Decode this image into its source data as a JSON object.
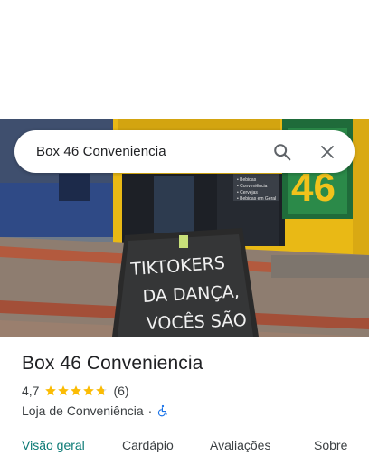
{
  "search": {
    "query": "Box 46 Conveniencia"
  },
  "place": {
    "title": "Box 46 Conveniencia",
    "rating": "4,7",
    "review_count": "(6)",
    "stars_filled": 4.7,
    "category": "Loja de Conveniência",
    "separator": "·"
  },
  "photo": {
    "sign_lines": [
      "TIKTOKERS",
      "DA DANÇA,",
      "VOCÊS SÃO"
    ],
    "storefront_number": "46"
  },
  "tabs": [
    {
      "label": "Visão geral",
      "active": true
    },
    {
      "label": "Cardápio",
      "active": false
    },
    {
      "label": "Avaliações",
      "active": false
    },
    {
      "label": "Sobre",
      "active": false
    }
  ],
  "colors": {
    "star": "#fbbc04",
    "active_tab": "#0b7a75",
    "accessibility_icon": "#1a73e8",
    "storefront_yellow": "#f2c21b",
    "storefront_green": "#1f6b3a"
  }
}
